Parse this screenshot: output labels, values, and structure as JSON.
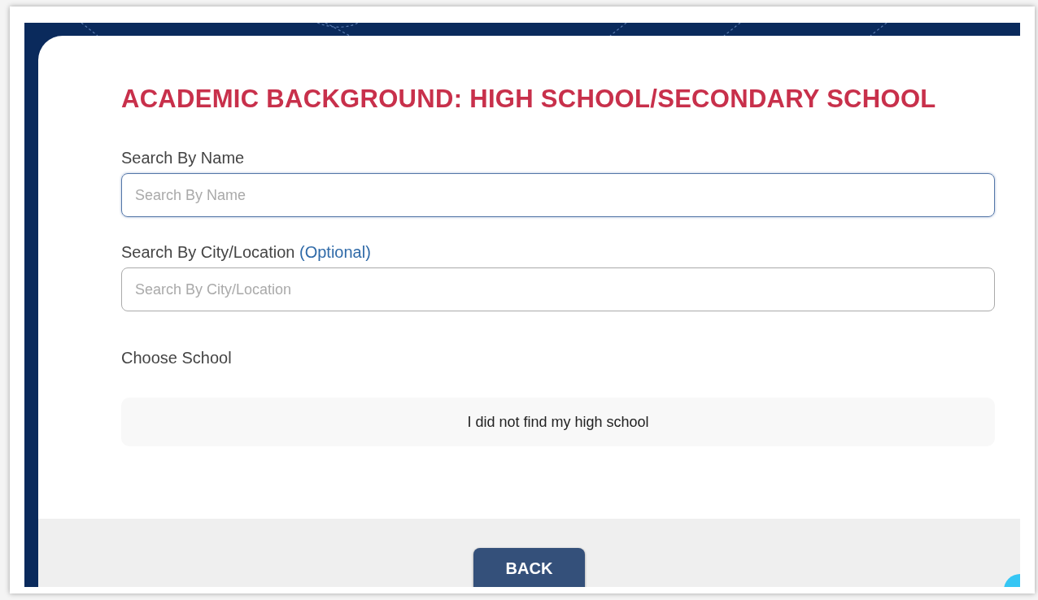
{
  "title": "ACADEMIC BACKGROUND: HIGH SCHOOL/SECONDARY SCHOOL",
  "fields": [
    {
      "label": "Search By Name",
      "placeholder": "Search By Name",
      "focused": true
    },
    {
      "label": "Search By City/Location",
      "note": "(Optional)",
      "placeholder": "Search By City/Location",
      "focused": false
    }
  ],
  "choose_label": "Choose School",
  "not_found_button": "I did not find my high school",
  "back_button": "BACK"
}
